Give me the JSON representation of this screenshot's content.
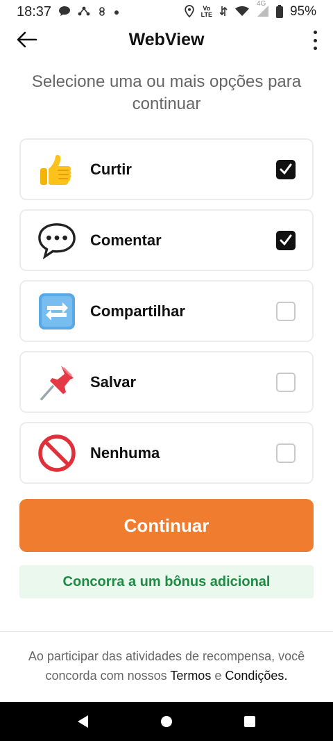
{
  "status_bar": {
    "time": "18:37",
    "network": "4G",
    "volte_top": "Vo",
    "volte_bottom": "LTE",
    "battery": "95%"
  },
  "app_bar": {
    "title": "WebView",
    "back_icon": "arrow-left-icon",
    "menu_icon": "more-vertical-icon"
  },
  "subtitle": "Selecione uma ou mais opções para continuar",
  "options": [
    {
      "label": "Curtir",
      "icon": "thumbs-up-icon",
      "checked": true
    },
    {
      "label": "Comentar",
      "icon": "speech-bubble-icon",
      "checked": true
    },
    {
      "label": "Compartilhar",
      "icon": "repeat-arrows-icon",
      "checked": false
    },
    {
      "label": "Salvar",
      "icon": "pushpin-icon",
      "checked": false
    },
    {
      "label": "Nenhuma",
      "icon": "prohibited-icon",
      "checked": false
    }
  ],
  "continue_label": "Continuar",
  "bonus_label": "Concorra a um bônus adicional",
  "terms": {
    "prefix": "Ao participar das atividades de recompensa, você concorda com nossos",
    "terms_link": "Termos",
    "conjunction": "e",
    "conditions_link": "Condições",
    "suffix": "."
  },
  "colors": {
    "accent": "#f07c2f",
    "bonus_bg": "#eaf8ee",
    "bonus_text": "#1e8a44"
  }
}
